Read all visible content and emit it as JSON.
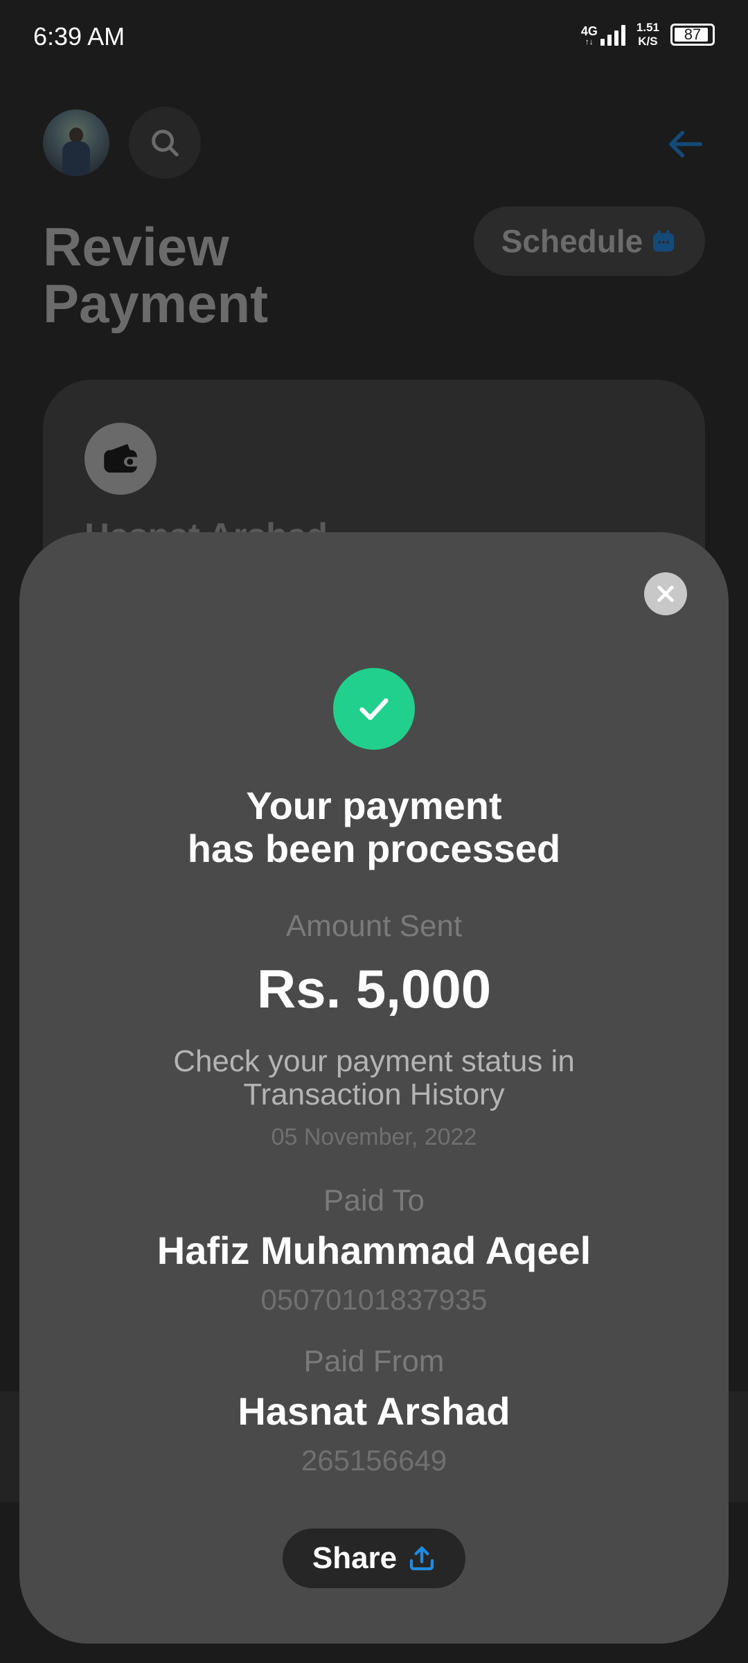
{
  "status_bar": {
    "time": "6:39 AM",
    "network": "4G",
    "speed_top": "1.51",
    "speed_bottom": "K/S",
    "battery": "87"
  },
  "background": {
    "title_line1": "Review",
    "title_line2": "Payment",
    "schedule_label": "Schedule",
    "card_name": "Hasnat Arshad"
  },
  "modal": {
    "heading_line1": "Your payment",
    "heading_line2": "has been processed",
    "amount_label": "Amount Sent",
    "amount_value": "Rs. 5,000",
    "status_line1": "Check your payment status in",
    "status_line2": "Transaction History",
    "date": "05 November, 2022",
    "paid_to_label": "Paid To",
    "paid_to_name": "Hafiz Muhammad Aqeel",
    "paid_to_account": "05070101837935",
    "paid_from_label": "Paid From",
    "paid_from_name": "Hasnat Arshad",
    "paid_from_account": "265156649",
    "share_label": "Share"
  },
  "colors": {
    "accent_green": "#21d08c",
    "accent_blue": "#1f7fd6",
    "modal_bg": "#4a4a4a",
    "page_bg": "#1b1b1b"
  }
}
